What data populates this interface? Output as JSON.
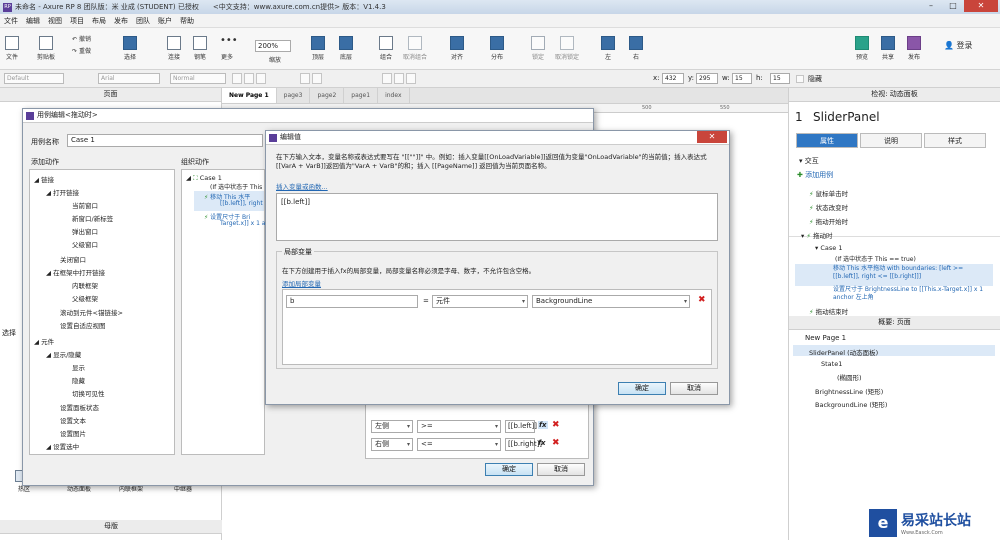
{
  "window": {
    "title": "未命名 - Axure RP 8 团队版：米 业成 (STUDENT) 已授权　　<中文支持：www.axure.com.cn提供> 版本：V1.4.3"
  },
  "menu": [
    "文件",
    "编辑",
    "视图",
    "项目",
    "布局",
    "发布",
    "团队",
    "账户",
    "帮助"
  ],
  "toolbar": {
    "file": "文件",
    "clipboard": "剪贴板",
    "undo": "撤销",
    "redo": "重做",
    "select": "选择",
    "connect": "连接",
    "pen": "钢笔",
    "more": "更多",
    "zoom_value": "200%",
    "zoom": "缩放",
    "top": "顶层",
    "bottom": "底层",
    "group": "组合",
    "ungroup": "取消组合",
    "align": "对齐",
    "distribute": "分布",
    "lock": "锁定",
    "unlock": "取消锁定",
    "left": "左",
    "right": "右",
    "preview": "预览",
    "share": "共享",
    "publish": "发布",
    "login": "登录"
  },
  "format": {
    "style": "Default",
    "font": "Arial",
    "weight": "Normal",
    "x_label": "x:",
    "x": "432",
    "y_label": "y:",
    "y": "295",
    "w_label": "w:",
    "w": "15",
    "h_label": "h:",
    "h": "15",
    "hidden": "隐藏"
  },
  "left_panel": {
    "pages": "页面",
    "library": "选择",
    "masters": "母版"
  },
  "widgets": {
    "hotspot": "热区",
    "dynamic_panel": "动态面板",
    "inline_frame": "内联框架",
    "repeater": "中继器"
  },
  "page_tabs": [
    "New Page 1",
    "page3",
    "page2",
    "page1",
    "index"
  ],
  "ruler": {
    "m1": "500",
    "m2": "550"
  },
  "case_editor": {
    "title": "用例编辑<拖动时>",
    "case_name_label": "用例名称",
    "case_name": "Case 1",
    "add_action": "添加动作",
    "organize_action": "组织动作",
    "tree": [
      "链接",
      "打开链接",
      "当前窗口",
      "新窗口/新标签",
      "弹出窗口",
      "父级窗口",
      "关闭窗口",
      "在框架中打开链接",
      "内联框架",
      "父级框架",
      "滚动到元件<锚链接>",
      "设置自适应视图",
      "元件",
      "显示/隐藏",
      "显示",
      "隐藏",
      "切换可见性",
      "设置面板状态",
      "设置文本",
      "设置图片",
      "设置选中"
    ],
    "org": {
      "case": "Case 1",
      "cond": "(If 选中状态于 This",
      "move": "移动 This 水平",
      "move2": "[[b.left]], right <",
      "resize": "设置尺寸于 Bri",
      "resize2": "Target.x]] x 1 an"
    },
    "rows": [
      {
        "side": "左侧",
        "op": ">=",
        "val": "[[b.left]]"
      },
      {
        "side": "右侧",
        "op": "<=",
        "val": "[[b.right]]"
      }
    ],
    "ok": "确定",
    "cancel": "取消"
  },
  "edit_value": {
    "title": "编辑值",
    "desc": "在下方输入文本，变量名称或表达式要写在 \"[[\"\"]]\" 中。例如：插入变量[[OnLoadVariable]]返回值为变量\"OnLoadVariable\"的当前值；插入表达式[[VarA + VarB]]返回值为\"VarA + VarB\"的和；插入 [[PageName]] 返回值为当前页面名称。",
    "insert_link": "插入变量或函数...",
    "expression": "[[b.left]]",
    "local_vars": "局部变量",
    "local_desc": "在下方创建用于插入fx的局部变量，局部变量名称必须是字母、数字，不允许包含空格。",
    "add_local": "添加局部变量",
    "var_name": "b",
    "eq": "=",
    "var_type": "元件",
    "var_target": "BackgroundLine",
    "ok": "确定",
    "cancel": "取消"
  },
  "right_panel": {
    "inspector": "检视: 动态面板",
    "index": "1",
    "name": "SliderPanel",
    "tabs": [
      "属性",
      "说明",
      "样式"
    ],
    "interaction": "交互",
    "add_case": "添加用例",
    "events": [
      "鼠标单击时",
      "状态改变时",
      "拖动开始时",
      "拖动时"
    ],
    "case": "Case 1",
    "cond": "(If 选中状态于 This == true)",
    "move": "移动 This 水平拖动 with boundaries: [left >= [[b.left]], right <= [[b.right]]]",
    "resize": "设置尺寸于 BrightnessLine to [[This.x-Target.x]] x 1 anchor 左上角",
    "drag_end": "拖动结束时",
    "outline_head": "概要: 页面",
    "outline": [
      "New Page 1",
      "SliderPanel (动态面板)",
      "State1",
      "(椭圆形)",
      "BrightnessLine (矩形)",
      "BackgroundLine (矩形)"
    ]
  },
  "watermark": {
    "text": "易采站长站",
    "sub": "Www.Easck.Com"
  }
}
